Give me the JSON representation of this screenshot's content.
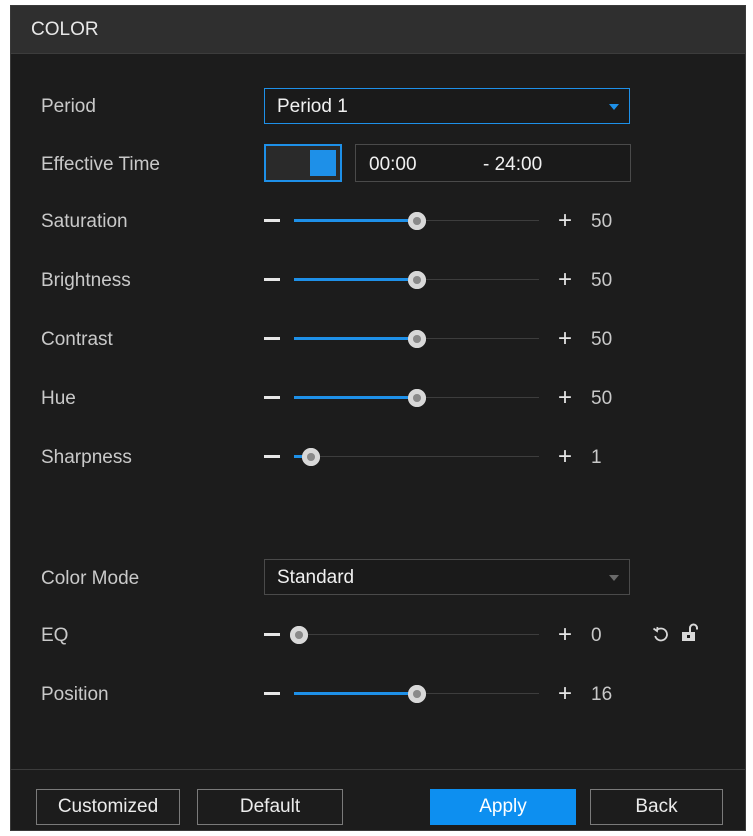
{
  "window": {
    "title": "COLOR"
  },
  "period": {
    "label": "Period",
    "value": "Period 1"
  },
  "effective_time": {
    "label": "Effective Time",
    "enabled": true,
    "start": "00:00",
    "end": "- 24:00"
  },
  "sliders": {
    "saturation": {
      "label": "Saturation",
      "value": "50",
      "fraction": 0.5
    },
    "brightness": {
      "label": "Brightness",
      "value": "50",
      "fraction": 0.5
    },
    "contrast": {
      "label": "Contrast",
      "value": "50",
      "fraction": 0.5
    },
    "hue": {
      "label": "Hue",
      "value": "50",
      "fraction": 0.5
    },
    "sharpness": {
      "label": "Sharpness",
      "value": "1",
      "fraction": 0.07
    },
    "eq": {
      "label": "EQ",
      "value": "0",
      "fraction": 0.02
    },
    "position": {
      "label": "Position",
      "value": "16",
      "fraction": 0.5
    }
  },
  "color_mode": {
    "label": "Color Mode",
    "value": "Standard"
  },
  "controls": {
    "minus": "−",
    "plus": "+"
  },
  "icons": {
    "reset": "reset-icon",
    "lock": "unlock-icon",
    "dropdown": "chevron-down-icon"
  },
  "buttons": {
    "customized": "Customized",
    "default": "Default",
    "apply": "Apply",
    "back": "Back"
  },
  "colors": {
    "accent": "#1e90e8",
    "background": "#1c1c1c",
    "primary_button": "#0d8ff0"
  }
}
